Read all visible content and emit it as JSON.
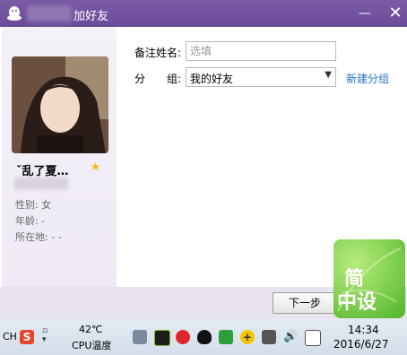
{
  "dialog": {
    "title": "加好友",
    "remark_label": "备注姓名:",
    "remark_placeholder": "选填",
    "group_label": "分　　组:",
    "group_value": "我的好友",
    "new_group_link": "新建分组",
    "next_button": "下一步",
    "minimize_glyph": "—",
    "close_glyph": "✕"
  },
  "profile": {
    "name": "ˇ乱了夏…",
    "star": "★",
    "gender": "性别: 女",
    "age": "年龄:  -",
    "location": "所在地:  -   -"
  },
  "watermark": {
    "line1": "简",
    "line2": "中设"
  },
  "taskbar": {
    "lang": "CH",
    "temperature": "42℃",
    "cpu_label": "CPU温度",
    "time": "14:34",
    "date": "2016/6/27"
  },
  "colors": {
    "titlebar": "#6c4c98",
    "link": "#2a73c5",
    "star": "#f5b400"
  },
  "icons": [
    "qq-icon",
    "sogou-s-icon",
    "nvidia-icon",
    "netease-music-icon",
    "qq-tray-icon",
    "security-shield-icon",
    "plus-icon",
    "volume-icon",
    "network-icon"
  ]
}
